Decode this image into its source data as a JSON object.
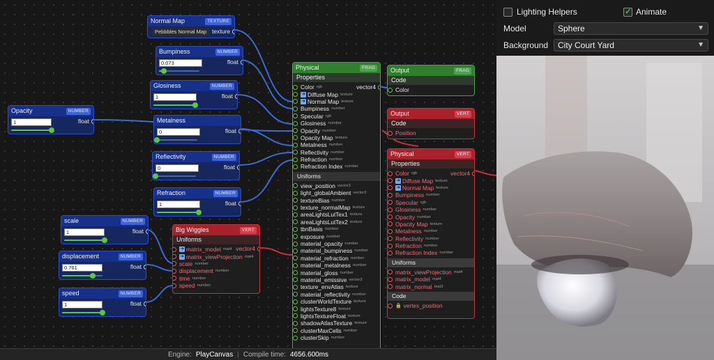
{
  "nodes": {
    "normal_map": {
      "title": "Normal Map",
      "tag": "TEXTURE",
      "value": "Pebbbles Normal Map",
      "out": "texture"
    },
    "bumpiness": {
      "title": "Bumpiness",
      "tag": "NUMBER",
      "value": "0.073",
      "out": "float",
      "level": 0.12
    },
    "glosiness": {
      "title": "Glosiness",
      "tag": "NUMBER",
      "value": "1",
      "out": "float",
      "level": 1.0
    },
    "opacity": {
      "title": "Opacity",
      "tag": "NUMBER",
      "value": "1",
      "out": "float",
      "level": 1.0
    },
    "metalness": {
      "title": "Metalness",
      "tag": "NUMBER",
      "value": "0",
      "out": "float",
      "level": 0.0
    },
    "reflectivity": {
      "title": "Reflectivity",
      "tag": "NUMBER",
      "value": "0",
      "out": "float",
      "level": 0.0
    },
    "refraction": {
      "title": "Refraction",
      "tag": "NUMBER",
      "value": "1",
      "out": "float",
      "level": 1.0
    },
    "scale": {
      "title": "scale",
      "tag": "NUMBER",
      "value": "1",
      "out": "float",
      "level": 1.0
    },
    "displacement": {
      "title": "displacement",
      "tag": "NUMBER",
      "value": "0.761",
      "out": "float",
      "level": 0.76
    },
    "speed": {
      "title": "speed",
      "tag": "NUMBER",
      "value": "1",
      "out": "float",
      "level": 1.0
    }
  },
  "physical_frag": {
    "title": "Physical",
    "tag": "FRAG",
    "properties_label": "Properties",
    "uniforms_label": "Uniforms",
    "out": "vector4",
    "properties": [
      {
        "name": "Color",
        "type": "rgb"
      },
      {
        "name": "Diffuse Map",
        "type": "texture",
        "arrow": true
      },
      {
        "name": "Normal Map",
        "type": "texture",
        "arrow": true
      },
      {
        "name": "Bumpiness",
        "type": "number"
      },
      {
        "name": "Specular",
        "type": "rgb"
      },
      {
        "name": "Glosiness",
        "type": "number"
      },
      {
        "name": "Opacity",
        "type": "number"
      },
      {
        "name": "Opacity Map",
        "type": "texture"
      },
      {
        "name": "Metalness",
        "type": "number"
      },
      {
        "name": "Reflectivity",
        "type": "number"
      },
      {
        "name": "Refraction",
        "type": "number"
      },
      {
        "name": "Refraction Index",
        "type": "number"
      }
    ],
    "uniforms": [
      {
        "name": "view_position",
        "type": "vector3"
      },
      {
        "name": "light_globalAmbient",
        "type": "vector3"
      },
      {
        "name": "textureBias",
        "type": "number"
      },
      {
        "name": "texture_normalMap",
        "type": "texture"
      },
      {
        "name": "areaLightsLutTex1",
        "type": "texture"
      },
      {
        "name": "areaLightsLutTex2",
        "type": "texture"
      },
      {
        "name": "tbnBasis",
        "type": "number"
      },
      {
        "name": "exposure",
        "type": "number"
      },
      {
        "name": "material_opacity",
        "type": "number"
      },
      {
        "name": "material_bumpiness",
        "type": "number"
      },
      {
        "name": "material_refraction",
        "type": "number"
      },
      {
        "name": "material_metalness",
        "type": "number"
      },
      {
        "name": "material_gloss",
        "type": "number"
      },
      {
        "name": "material_emissive",
        "type": "vector3"
      },
      {
        "name": "texture_envAtlas",
        "type": "texture"
      },
      {
        "name": "material_reflectivity",
        "type": "number"
      },
      {
        "name": "clusterWorldTexture",
        "type": "texture"
      },
      {
        "name": "lightsTexture8",
        "type": "texture"
      },
      {
        "name": "lightsTextureFloat",
        "type": "texture"
      },
      {
        "name": "shadowAtlasTexture",
        "type": "texture"
      },
      {
        "name": "clusterMaxCells",
        "type": "number"
      },
      {
        "name": "clusterSkip",
        "type": "number"
      }
    ]
  },
  "output_frag": {
    "title": "Output",
    "tag": "FRAG",
    "code_label": "Code",
    "input": "Color"
  },
  "output_vert": {
    "title": "Output",
    "tag": "VERT",
    "code_label": "Code",
    "input": "Position"
  },
  "physical_vert": {
    "title": "Physical",
    "tag": "VERT",
    "properties_label": "Properties",
    "uniforms_label": "Uniforms",
    "code_label": "Code",
    "out": "vector4",
    "properties": [
      {
        "name": "Color",
        "type": "rgb"
      },
      {
        "name": "Diffuse Map",
        "type": "texture",
        "arrow": true
      },
      {
        "name": "Normal Map",
        "type": "texture",
        "arrow": true
      },
      {
        "name": "Bumpiness",
        "type": "number"
      },
      {
        "name": "Specular",
        "type": "rgb"
      },
      {
        "name": "Glosiness",
        "type": "number"
      },
      {
        "name": "Opacity",
        "type": "number"
      },
      {
        "name": "Opacity Map",
        "type": "texture"
      },
      {
        "name": "Metalness",
        "type": "number"
      },
      {
        "name": "Reflectivity",
        "type": "number"
      },
      {
        "name": "Refraction",
        "type": "number"
      },
      {
        "name": "Refraction Index",
        "type": "number"
      }
    ],
    "uniforms": [
      {
        "name": "matrix_viewProjection",
        "type": "mat4"
      },
      {
        "name": "matrix_model",
        "type": "mat4"
      },
      {
        "name": "matrix_normal",
        "type": "mat3"
      }
    ],
    "code_item": "vertex_position"
  },
  "big_wiggles": {
    "title": "Big Wiggles",
    "tag": "VERT",
    "uniforms_label": "Uniforms",
    "out": "vector4",
    "items": [
      {
        "name": "matrix_model",
        "type": "mat4"
      },
      {
        "name": "matrix_viewProjection",
        "type": "mat4"
      },
      {
        "name": "scale",
        "type": "number"
      },
      {
        "name": "displacement",
        "type": "number"
      },
      {
        "name": "time",
        "type": "number"
      },
      {
        "name": "speed",
        "type": "number"
      }
    ]
  },
  "statusbar": {
    "engine_label": "Engine:",
    "engine": "PlayCanvas",
    "compile_label": "Compile time:",
    "compile": "4656.600ms"
  },
  "settings": {
    "lighting_helpers": "Lighting Helpers",
    "lighting_helpers_checked": false,
    "animate": "Animate",
    "animate_checked": true,
    "model_label": "Model",
    "model": "Sphere",
    "background_label": "Background",
    "background": "City Court Yard"
  },
  "colors": {
    "wire_blue": "#3b6fe0",
    "wire_red": "#d4323c",
    "accent_green": "#59c93f"
  }
}
